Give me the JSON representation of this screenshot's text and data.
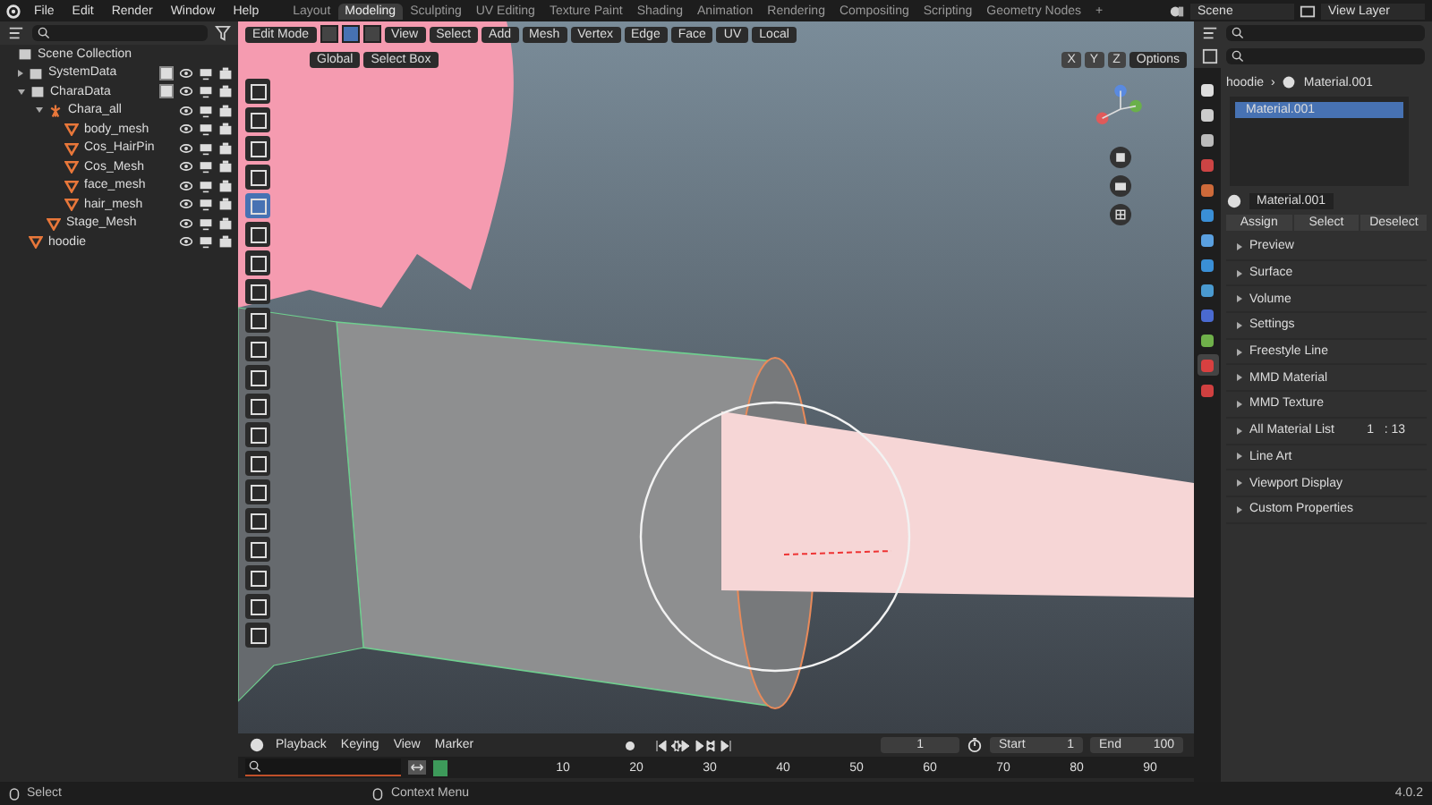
{
  "menu": [
    "File",
    "Edit",
    "Render",
    "Window",
    "Help"
  ],
  "workspaces": [
    {
      "label": "Layout",
      "selected": false
    },
    {
      "label": "Modeling",
      "selected": true
    },
    {
      "label": "Sculpting",
      "selected": false
    },
    {
      "label": "UV Editing",
      "selected": false
    },
    {
      "label": "Texture Paint",
      "selected": false
    },
    {
      "label": "Shading",
      "selected": false
    },
    {
      "label": "Animation",
      "selected": false
    },
    {
      "label": "Rendering",
      "selected": false
    },
    {
      "label": "Compositing",
      "selected": false
    },
    {
      "label": "Scripting",
      "selected": false
    },
    {
      "label": "Geometry Nodes",
      "selected": false
    },
    {
      "label": "+",
      "selected": false
    }
  ],
  "scene": "Scene",
  "view_layer": "View Layer",
  "outliner": {
    "root": "Scene Collection",
    "items": [
      {
        "label": "SystemData",
        "kind": "collection",
        "expanded": false,
        "checked": true
      },
      {
        "label": "CharaData",
        "kind": "collection",
        "expanded": true,
        "checked": true,
        "children": [
          {
            "label": "Chara_all",
            "kind": "armature",
            "expanded": true,
            "children": [
              {
                "label": "body_mesh",
                "kind": "mesh"
              },
              {
                "label": "Cos_HairPin",
                "kind": "mesh"
              },
              {
                "label": "Cos_Mesh",
                "kind": "mesh"
              },
              {
                "label": "face_mesh",
                "kind": "mesh"
              },
              {
                "label": "hair_mesh",
                "kind": "mesh"
              }
            ]
          },
          {
            "label": "Stage_Mesh",
            "kind": "mesh"
          }
        ]
      },
      {
        "label": "hoodie",
        "kind": "mesh"
      }
    ]
  },
  "viewport": {
    "mode": "Edit Mode",
    "select_modes": [
      {
        "selected": false
      },
      {
        "selected": true
      },
      {
        "selected": false
      }
    ],
    "menus": [
      "View",
      "Select",
      "Add",
      "Mesh",
      "Vertex",
      "Edge",
      "Face",
      "UV"
    ],
    "pivot": "Local",
    "orientation": "Global",
    "select_tool": "Select Box",
    "axes": [
      "X",
      "Y",
      "Z"
    ],
    "options": "Options",
    "tools": [
      {
        "selected": false
      },
      {
        "selected": false
      },
      {
        "selected": false
      },
      {
        "selected": false
      },
      {
        "selected": true
      },
      {
        "selected": false
      },
      {
        "selected": false
      },
      {
        "selected": false
      },
      {
        "selected": false
      },
      {
        "selected": false
      },
      {
        "selected": false
      },
      {
        "selected": false
      },
      {
        "selected": false
      },
      {
        "selected": false
      },
      {
        "selected": false
      },
      {
        "selected": false
      },
      {
        "selected": false
      },
      {
        "selected": false
      },
      {
        "selected": false
      },
      {
        "selected": false
      }
    ]
  },
  "properties": {
    "object": "hoodie",
    "separator": "›",
    "material": "Material.001",
    "slots": [
      {
        "label": "Material.001",
        "selected": true
      }
    ],
    "material_field": "Material.001",
    "buttons": [
      "Assign",
      "Select",
      "Deselect"
    ],
    "panels": [
      {
        "label": "Preview"
      },
      {
        "label": "Surface"
      },
      {
        "label": "Volume"
      },
      {
        "label": "Settings"
      },
      {
        "label": "Freestyle Line"
      },
      {
        "label": "MMD Material"
      },
      {
        "label": "MMD Texture"
      },
      {
        "label": "All Material List",
        "value": "1   : 13"
      },
      {
        "label": "Line Art"
      },
      {
        "label": "Viewport Display"
      },
      {
        "label": "Custom Properties"
      }
    ],
    "tabs": [
      {
        "selected": false
      },
      {
        "selected": false
      },
      {
        "selected": false
      },
      {
        "selected": false
      },
      {
        "selected": false
      },
      {
        "selected": false
      },
      {
        "selected": false
      },
      {
        "selected": false
      },
      {
        "selected": false
      },
      {
        "selected": false
      },
      {
        "selected": false
      },
      {
        "selected": true
      },
      {
        "selected": false
      }
    ]
  },
  "timeline": {
    "menus": [
      "Playback",
      "Keying",
      "View",
      "Marker"
    ],
    "current_frame": "1",
    "start_label": "Start",
    "start": "1",
    "end_label": "End",
    "end": "100",
    "ticks": [
      "10",
      "20",
      "30",
      "40",
      "50",
      "60",
      "70",
      "80",
      "90"
    ]
  },
  "status_bar": {
    "left": "Select",
    "middle": "Context Menu",
    "version": "4.0.2"
  }
}
